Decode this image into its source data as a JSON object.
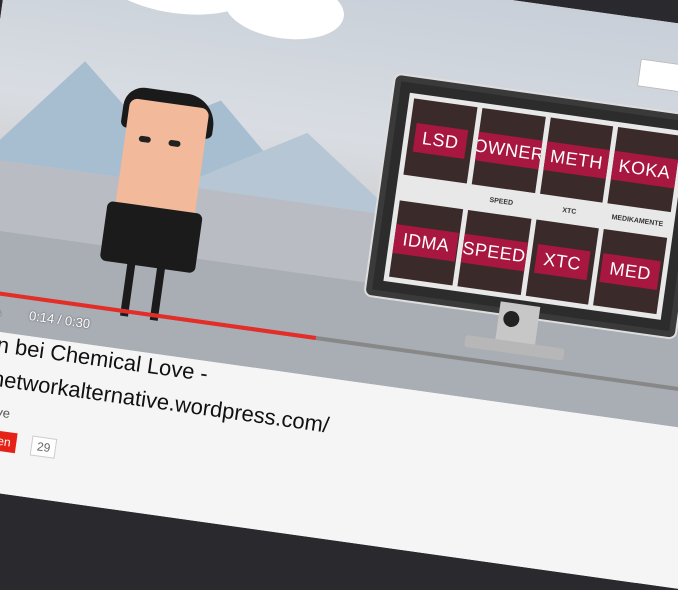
{
  "player": {
    "time": "0:14 / 0:30",
    "progress_fraction": 0.47
  },
  "monitor": {
    "tiles_top": [
      "LSD",
      "DOWNERS",
      "METH",
      "KOKA"
    ],
    "captions": [
      "SPEED",
      "XTC",
      "MEDIKAMENTE"
    ],
    "tiles_bottom": [
      "IDMA",
      "SPEED",
      "XTC",
      "MED"
    ]
  },
  "video_info": {
    "title_line1": "en bei Chemical Love -",
    "title_line2": "enetworkalternative.wordpress.com/",
    "channel": "l Love",
    "subscribe_label": "nieren",
    "subscriber_count": "29"
  },
  "search": {
    "button_icon": "search-icon"
  },
  "colors": {
    "accent": "#e52d27",
    "tile_label": "#a8173f"
  }
}
